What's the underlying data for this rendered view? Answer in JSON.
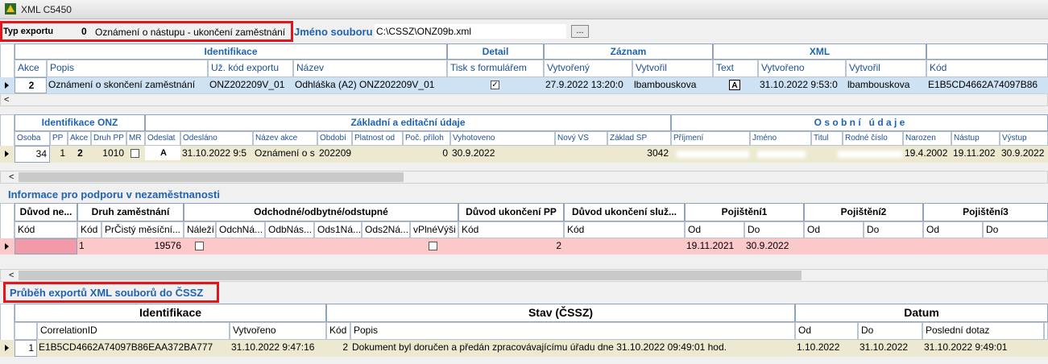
{
  "window": {
    "title": "XML C5450"
  },
  "top": {
    "typ_label": "Typ exportu",
    "typ_value": "0",
    "typ_desc": "Oznámení o nástupu - ukončení zaměstnání",
    "file_label": "Jméno souboru",
    "file_value": "C:\\CSSZ\\ONZ09b.xml",
    "browse_label": "..."
  },
  "grid1": {
    "groups": [
      "Identifikace",
      "Detail",
      "Záznam",
      "XML"
    ],
    "cols": [
      "Akce",
      "Popis",
      "Už. kód exportu",
      "Název",
      "Tisk s formulářem",
      "Vytvořený",
      "Vytvořil",
      "Text",
      "Vytvořeno",
      "Vytvořil",
      "Kód"
    ],
    "row": {
      "akce": "2",
      "popis": "Oznámení o skončení zaměstnání",
      "kod_exportu": "ONZ202209V_01",
      "nazev": "Odhláška (A2) ONZ202209V_01",
      "tisk_checked": "✓",
      "vytvoreny": "27.9.2022 13:20:0",
      "vytvoril": "lbambouskova",
      "text": "A",
      "vytvoreno": "31.10.2022 9:53:0",
      "vytvoril_xml": "lbambouskova",
      "kod": "E1B5CD4662A74097B86"
    }
  },
  "grid2": {
    "groups": [
      "Identifikace ONZ",
      "Základní a editační údaje",
      "O s o b n í   ú d a j e"
    ],
    "cols": [
      "Osoba",
      "PP",
      "Akce",
      "Druh PP",
      "MR",
      "Odeslat",
      "Odesláno",
      "Název akce",
      "Období",
      "Platnost od",
      "Poč. příloh",
      "Vyhotoveno",
      "Nový VS",
      "Základ SP",
      "Příjmení",
      "Jméno",
      "Titul",
      "Rodné číslo",
      "Narozen",
      "Nástup",
      "Výstup"
    ],
    "row": {
      "osoba": "34",
      "pp": "1",
      "akce": "2",
      "druh_pp": "1010",
      "odeslat": "A",
      "odeslano": "31.10.2022 9:5",
      "nazev_akce": "Oznámení o s",
      "obdobi": "202209",
      "poc_priloh": "0",
      "vyhotoveno": "30.9.2022",
      "zaklad_sp": "3042",
      "narozen": "19.4.2002",
      "nastup": "19.11.202",
      "vystup": "30.9.2022"
    }
  },
  "section3": {
    "title": "Informace pro podporu v nezaměstnanosti",
    "groups": [
      "Důvod ne...",
      "Druh zaměstnání",
      "Odchodné/odbytné/odstupné",
      "Důvod ukončení PP",
      "Důvod ukončení služ...",
      "Pojištění1",
      "Pojištění2",
      "Pojištění3"
    ],
    "cols": [
      "Kód",
      "Kód",
      "PrČistý měsíční...",
      "Náleží",
      "OdchNá...",
      "OdbNás...",
      "Ods1Ná...",
      "Ods2Ná...",
      "vPlnéVýši",
      "Kód",
      "Kód",
      "Od",
      "Do",
      "Od",
      "Do",
      "Od",
      "Do"
    ],
    "row": {
      "druh_kod": "1",
      "pr_cisty": "19576",
      "duvod_pp_kod": "2",
      "poj1_od": "19.11.2021",
      "poj1_do": "30.9.2022"
    }
  },
  "section4": {
    "title": "Průběh exportů XML souborů do ČSSZ",
    "groups": [
      "Identifikace",
      "Stav (ČSSZ)",
      "Datum"
    ],
    "cols": [
      "CorrelationID",
      "Vytvořeno",
      "Kód",
      "Popis",
      "Od",
      "Do",
      "Poslední dotaz"
    ],
    "row": {
      "num": "1",
      "correlation": "E1B5CD4662A74097B86EAA372BA777",
      "vytvoreno": "31.10.2022 9:47:16",
      "kod": "2",
      "popis": "Dokument byl doručen a předán zpracovávajícímu úřadu dne 31.10.2022 09:49:01 hod.",
      "od": "1.10.2022",
      "do": "31.10.2022",
      "posledni_dotaz": "31.10.2022 9:49:01"
    }
  }
}
